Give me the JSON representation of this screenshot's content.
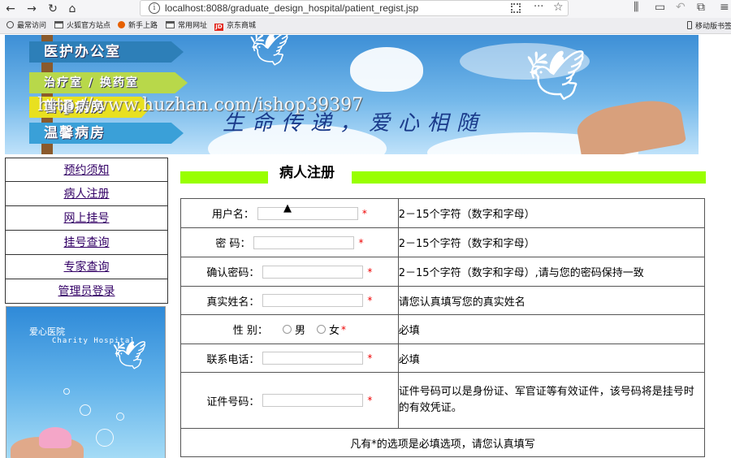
{
  "browser": {
    "url": "localhost:8088/graduate_design_hospital/patient_regist.jsp",
    "info_glyph": "i",
    "more_glyph": "···",
    "bookmarks": [
      {
        "label": "最常访问",
        "icon": "gear-icon"
      },
      {
        "label": "火狐官方站点",
        "icon": "folder-icon"
      },
      {
        "label": "新手上路",
        "icon": "firefox-icon"
      },
      {
        "label": "常用网址",
        "icon": "folder-icon"
      },
      {
        "label": "京东商城",
        "icon": "jd-icon"
      }
    ],
    "mobile_bookmarks": "移动版书签",
    "jd_icon_text": "JD"
  },
  "banner": {
    "signs": [
      "医护办公室",
      "治疗室 / 换药室",
      "普通病房",
      "温馨病房"
    ],
    "slogan": "生命传递，爱心相随",
    "watermark": "http://www.huzhan.com/ishop39397"
  },
  "sidebar": {
    "items": [
      {
        "label": "预约须知"
      },
      {
        "label": "病人注册"
      },
      {
        "label": "网上挂号"
      },
      {
        "label": "挂号查询"
      },
      {
        "label": "专家查询"
      },
      {
        "label": "管理员登录"
      }
    ],
    "image_title": "爱心医院",
    "image_subtitle": "Charity Hospital"
  },
  "page": {
    "title": "病人注册",
    "required_mark": "*",
    "footer_note": "凡有*的选项是必填选项，请您认真填写"
  },
  "form": {
    "username": {
      "label": "用户名：",
      "hint": "2－15个字符（数字和字母）"
    },
    "password": {
      "label": "密 码：",
      "hint": "2－15个字符（数字和字母）"
    },
    "confirm_password": {
      "label": "确认密码：",
      "hint": "2－15个字符（数字和字母）,请与您的密码保持一致"
    },
    "real_name": {
      "label": "真实姓名：",
      "hint": "请您认真填写您的真实姓名"
    },
    "gender": {
      "label": "性 别：",
      "option_male": "男",
      "option_female": "女",
      "hint": "必填"
    },
    "phone": {
      "label": "联系电话：",
      "hint": "必填"
    },
    "id_number": {
      "label": "证件号码：",
      "hint": "证件号码可以是身份证、军官证等有效证件，该号码将是挂号时的有效凭证。"
    }
  },
  "colors": {
    "title_bar": "#99ff00",
    "nav_link": "#330066",
    "required": "#ee0000"
  }
}
